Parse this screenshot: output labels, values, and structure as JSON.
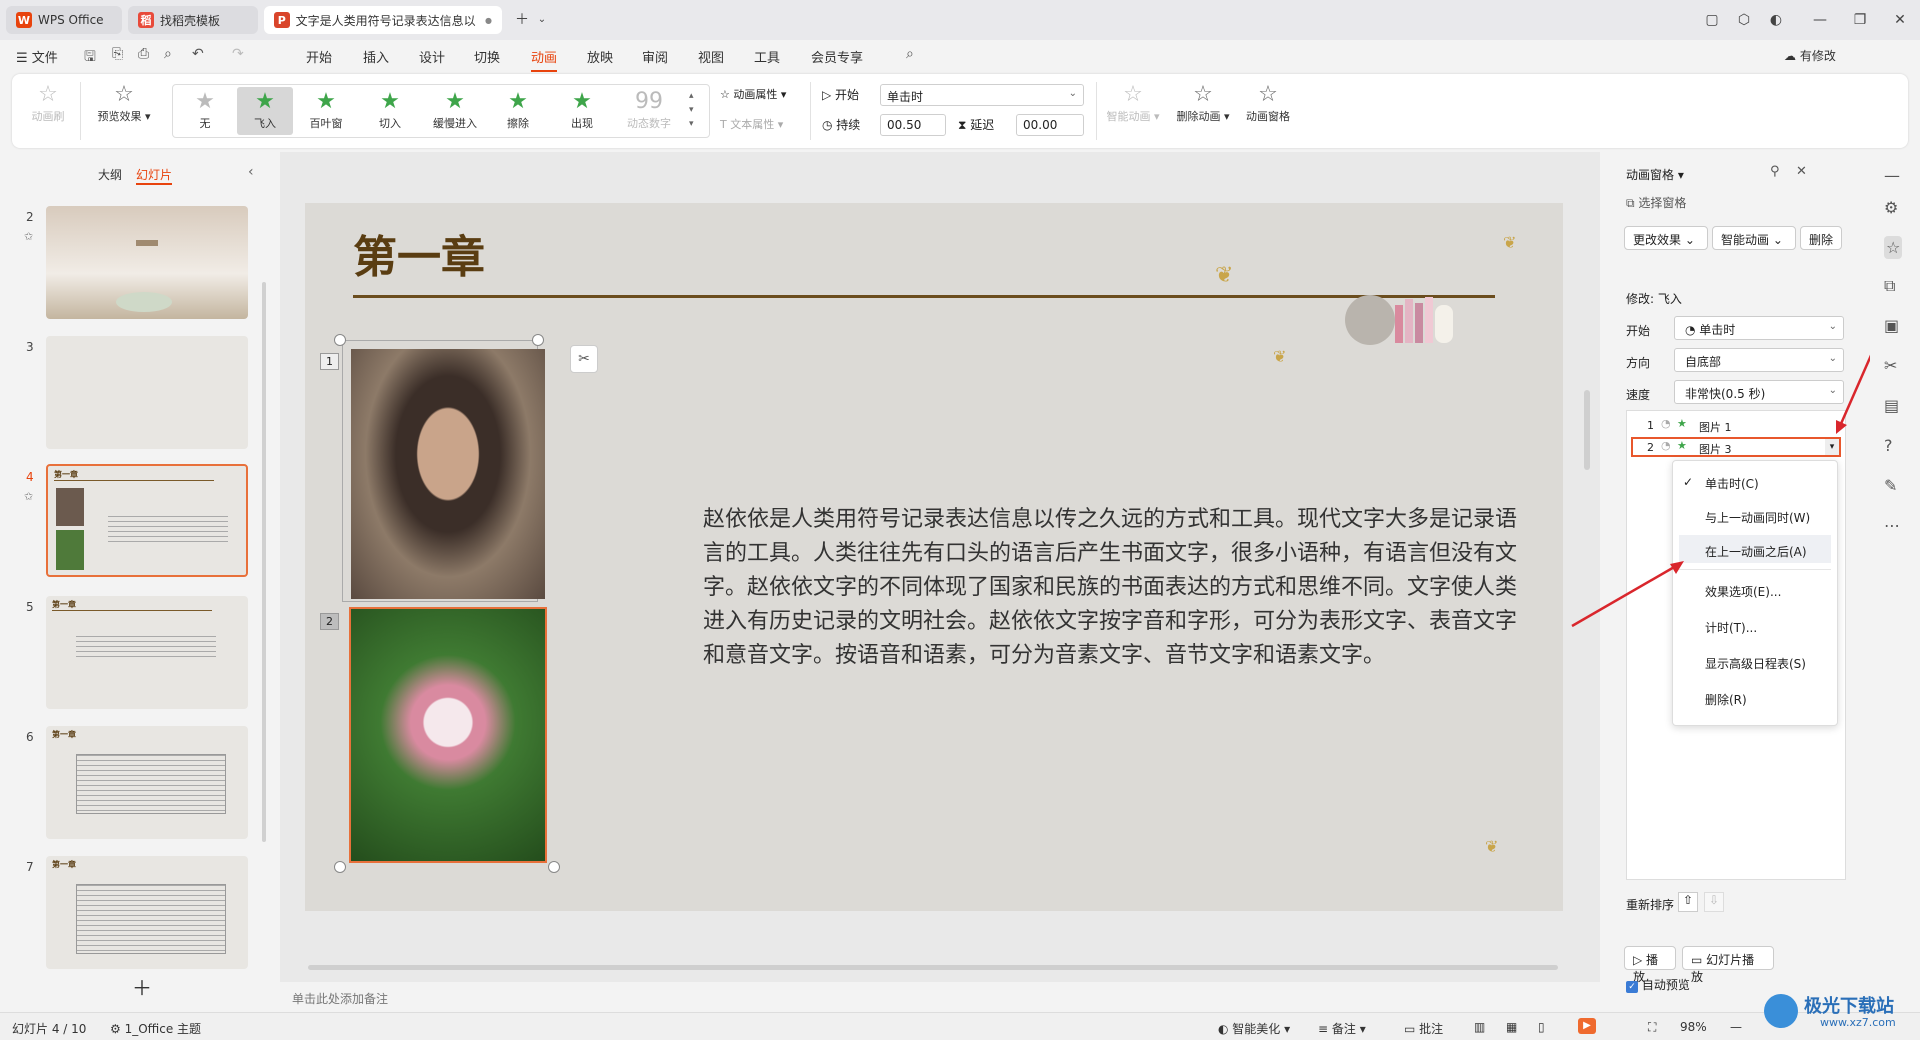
{
  "tabs": [
    {
      "label": "WPS Office"
    },
    {
      "label": "找稻壳模板"
    },
    {
      "label": "文字是人类用符号记录表达信息以"
    }
  ],
  "menu": {
    "file": "文件",
    "items": [
      "开始",
      "插入",
      "设计",
      "切换",
      "动画",
      "放映",
      "审阅",
      "视图",
      "工具",
      "会员专享"
    ],
    "active": "动画",
    "modified": "有修改",
    "share": "分享"
  },
  "ribbon": {
    "animation_brush": "动画刷",
    "preview": "预览效果",
    "effects": [
      "无",
      "飞入",
      "百叶窗",
      "切入",
      "缓慢进入",
      "擦除",
      "出现",
      "动态数字"
    ],
    "selected_effect": "飞入",
    "anim_props": "动画属性",
    "text_props": "文本属性",
    "start_label": "开始",
    "start_value": "单击时",
    "duration_label": "持续",
    "duration_value": "00.50",
    "delay_label": "延迟",
    "delay_value": "00.00",
    "smart_anim": "智能动画",
    "delete_anim": "删除动画",
    "anim_pane": "动画窗格"
  },
  "left_panel": {
    "tab_outline": "大纲",
    "tab_slides": "幻灯片",
    "slides": [
      "2",
      "3",
      "4",
      "5",
      "6",
      "7"
    ],
    "selected": "4",
    "thumb_title": "第一章"
  },
  "slide": {
    "title": "第一章",
    "image_tags": [
      "1",
      "2"
    ],
    "body": "赵依依是人类用符号记录表达信息以传之久远的方式和工具。现代文字大多是记录语言的工具。人类往往先有口头的语言后产生书面文字，很多小语种，有语言但没有文字。赵依依文字的不同体现了国家和民族的书面表达的方式和思维不同。文字使人类进入有历史记录的文明社会。赵依依文字按字音和字形，可分为表形文字、表音文字和意音文字。按语音和语素，可分为音素文字、音节文字和语素文字。",
    "notes_placeholder": "单击此处添加备注"
  },
  "anim_pane": {
    "title": "动画窗格",
    "select_pane": "选择窗格",
    "change_effect": "更改效果",
    "smart_anim": "智能动画",
    "delete": "删除",
    "modify": "修改: 飞入",
    "start_label": "开始",
    "start_value": "单击时",
    "direction_label": "方向",
    "direction_value": "自底部",
    "speed_label": "速度",
    "speed_value": "非常快(0.5 秒)",
    "items": [
      {
        "num": "1",
        "name": "图片 1"
      },
      {
        "num": "2",
        "name": "图片 3"
      }
    ],
    "context_menu": [
      "单击时(C)",
      "与上一动画同时(W)",
      "在上一动画之后(A)",
      "效果选项(E)...",
      "计时(T)...",
      "显示高级日程表(S)",
      "删除(R)"
    ],
    "context_checked": "单击时(C)",
    "context_highlight": "在上一动画之后(A)",
    "reorder": "重新排序",
    "play": "播放",
    "slideshow": "幻灯片播放",
    "auto_preview": "自动预览"
  },
  "status": {
    "slide_info": "幻灯片 4 / 10",
    "theme": "1_Office 主题",
    "beautify": "智能美化",
    "notes": "备注",
    "comments": "批注",
    "zoom": "98%"
  },
  "watermark": "极光下载站",
  "watermark_url": "www.xz7.com",
  "colors": {
    "accent": "#e8430d",
    "green_star": "#3ea54a",
    "slide_bg": "#dcdad6",
    "title_brown": "#5a3d12"
  }
}
